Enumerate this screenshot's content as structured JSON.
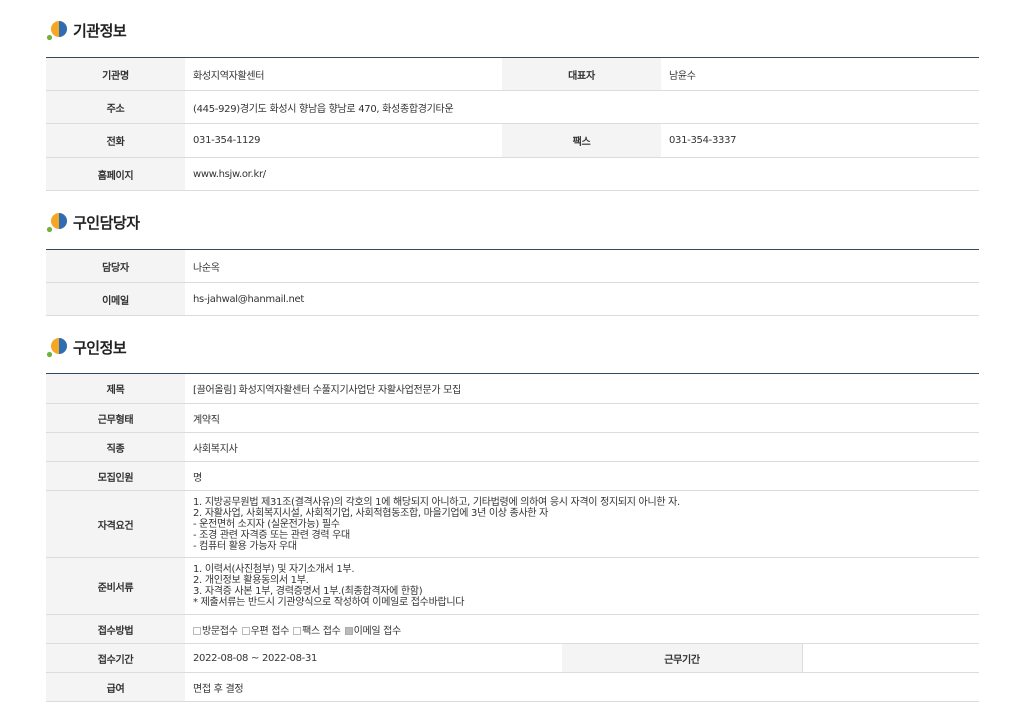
{
  "sections": {
    "org": {
      "title": "기관정보"
    },
    "contact": {
      "title": "구인담당자"
    },
    "job": {
      "title": "구인정보"
    }
  },
  "org": {
    "name_label": "기관명",
    "name": "화성지역자활센터",
    "rep_label": "대표자",
    "rep": "남윤수",
    "addr_label": "주소",
    "addr": "(445-929)경기도 화성시 향남읍 향남로 470, 화성종합경기타운",
    "tel_label": "전화",
    "tel": "031-354-1129",
    "fax_label": "팩스",
    "fax": "031-354-3337",
    "home_label": "홈페이지",
    "home": "www.hsjw.or.kr/"
  },
  "contact": {
    "person_label": "담당자",
    "person": "나순옥",
    "email_label": "이메일",
    "email": "hs-jahwal@hanmail.net"
  },
  "job": {
    "title_label": "제목",
    "title": "[끌어올림] 화성지역자활센터 수풀지기사업단 자활사업전문가 모집",
    "type_label": "근무형태",
    "type": "계약직",
    "occ_label": "직종",
    "occ": "사회복지사",
    "count_label": "모집인원",
    "count": "명",
    "qual_label": "자격요건",
    "qual": "1. 지방공무원법 제31조(결격사유)의 각호의 1에 해당되지 아니하고, 기타법령에 의하여 응시 자격이 정지되지 아니한 자.\n2. 자활사업, 사회복지시설, 사회적기업, 사회적협동조합, 마을기업에 3년 이상 종사한 자\n - 운전면허 소지자 (실운전가능) 필수\n - 조경 관련 자격증 또는 관련 경력 우대\n - 컴퓨터 활용 가능자 우대",
    "docs_label": "준비서류",
    "docs": " 1. 이력서(사진첨부) 및 자기소개서 1부.\n 2. 개인정보 활용동의서 1부.\n 3. 자격증 사본 1부, 경력증명서 1부.(최종합격자에 한함)\n* 제출서류는 반드시 기관양식으로 작성하여 이메일로 접수바랍니다",
    "method_label": "접수방법",
    "methods": [
      {
        "label": "방문접수",
        "checked": false
      },
      {
        "label": "우편 접수",
        "checked": false
      },
      {
        "label": "팩스 접수",
        "checked": false
      },
      {
        "label": "이메일 접수",
        "checked": true
      }
    ],
    "period_label": "접수기간",
    "period": "2022-08-08 ~ 2022-08-31",
    "work_period_label": "근무기간",
    "work_period": "",
    "pay_label": "급여",
    "pay": "면접 후 결정"
  }
}
